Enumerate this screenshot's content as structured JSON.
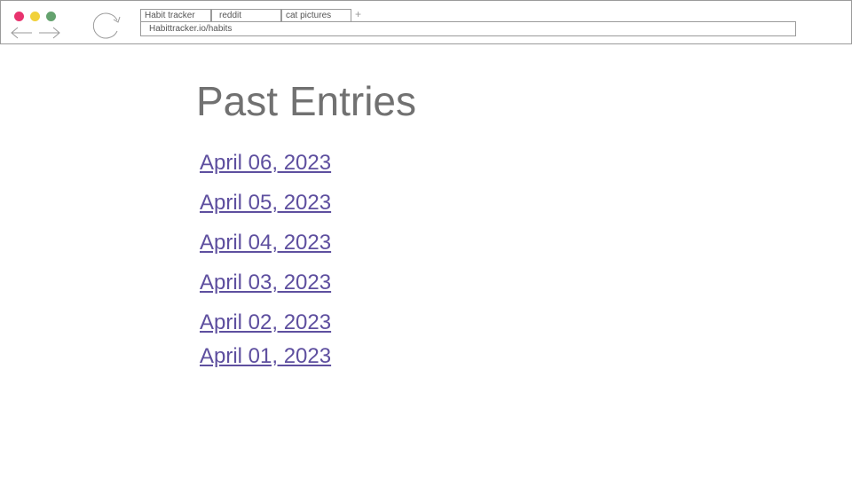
{
  "browser": {
    "tabs": [
      {
        "label": "Habit tracker"
      },
      {
        "label": "reddit"
      },
      {
        "label": "cat pictures"
      }
    ],
    "new_tab_label": "+",
    "url": "Habittracker.io/habits",
    "colors": {
      "close": "#e8336e",
      "minimize": "#f1d13a",
      "maximize": "#64a26e",
      "chrome_stroke": "#9a9a9a"
    },
    "icons": [
      "back-arrow-icon",
      "forward-arrow-icon",
      "reload-icon"
    ]
  },
  "page": {
    "title": "Past Entries",
    "entries": [
      {
        "label": "April 06, 2023"
      },
      {
        "label": "April 05, 2023"
      },
      {
        "label": "April 04, 2023"
      },
      {
        "label": "April 03, 2023"
      },
      {
        "label": "April 02, 2023"
      },
      {
        "label": "April 01, 2023"
      }
    ],
    "colors": {
      "title": "#717171",
      "link": "#5e4f9f"
    }
  }
}
